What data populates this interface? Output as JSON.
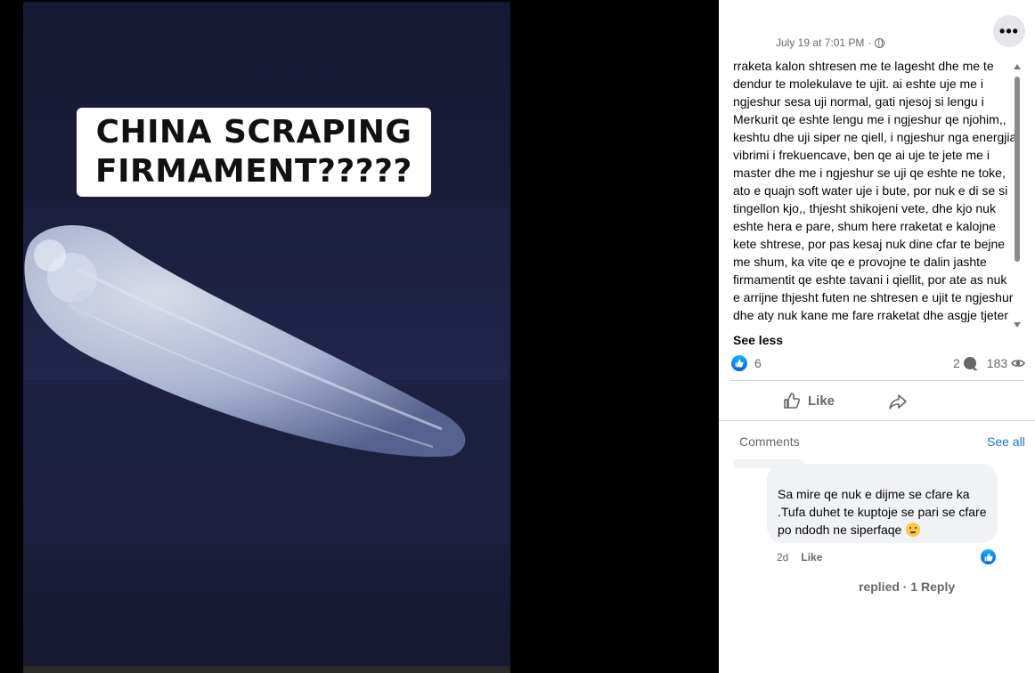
{
  "video": {
    "overlay_text": "CHINA SCRAPING\nFIRMAMENT?????"
  },
  "post": {
    "timestamp": "July 19 at 7:01 PM",
    "separator": "·",
    "more_icon": "more-horizontal-icon",
    "body": "rraketa kalon shtresen me te lagesht dhe me te dendur te molekulave te ujit. ai eshte uje me i ngjeshur sesa uji normal, gati njesoj si lengu i Merkurit qe eshte lengu me i ngjeshur qe njohim,, keshtu dhe uji siper ne qiell, i ngjeshur nga energjia vibrimi i frekuencave, ben qe ai uje te jete me i master dhe me i ngjeshur se uji qe eshte ne toke, ato e quajn soft water uje i bute, por nuk e di se si tingellon kjo,, thjesht shikojeni vete, dhe kjo nuk eshte hera e pare, shum here rraketat e kalojne kete shtrese, por pas kesaj nuk dine cfar te bejne me shum, ka vite qe e provojne te dalin jashte firmamentit qe eshte tavani i qiellit, por ate as nuk e arrijne thjesht futen ne shtresen e ujit te ngjeshur dhe aty nuk kane me fare rraketat dhe asgje tjeter",
    "see_less": "See less",
    "reaction_count": "6",
    "comment_count": "2",
    "view_count": "183",
    "like_label": "Like"
  },
  "comments": {
    "header": "Comments",
    "see_all": "See all",
    "items": [
      {
        "text": "Sa mire qe nuk e dijme se cfare ka .Tufa duhet te kuptoje se pari se cfare po ndodh ne siperfaqe",
        "emoji": "slightly-frowning-face",
        "age": "2d",
        "like_label": "Like"
      }
    ],
    "replies_label": "replied · 1 Reply"
  },
  "colors": {
    "link_blue": "#216fdb",
    "meta_gray": "#65676b",
    "bubble_bg": "#f0f2f5"
  }
}
